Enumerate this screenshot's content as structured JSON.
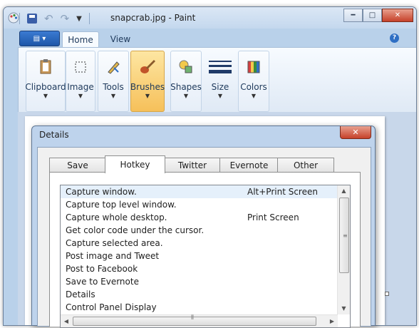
{
  "paint": {
    "title": "snapcrab.jpg - Paint",
    "tabs": [
      "Home",
      "View"
    ],
    "groups": [
      {
        "label": "Clipboard",
        "icon": "clipboard-icon"
      },
      {
        "label": "Image",
        "icon": "select-icon"
      },
      {
        "label": "Tools",
        "icon": "pencil-icon"
      },
      {
        "label": "Brushes",
        "icon": "brush-icon",
        "selected": true
      },
      {
        "label": "Shapes",
        "icon": "shapes-icon"
      },
      {
        "label": "Size",
        "icon": "line-size-icon"
      },
      {
        "label": "Colors",
        "icon": "color-palette-icon"
      }
    ],
    "help_glyph": "?"
  },
  "dialog": {
    "title": "Details",
    "close_glyph": "✕",
    "tabs": [
      "Save",
      "Hotkey",
      "Twitter",
      "Evernote",
      "Other"
    ],
    "active_tab": "Hotkey",
    "rows": [
      {
        "action": "Capture window.",
        "key": "Alt+Print Screen"
      },
      {
        "action": "Capture top level window.",
        "key": ""
      },
      {
        "action": "Capture whole desktop.",
        "key": "Print Screen"
      },
      {
        "action": "Get color code under the cursor.",
        "key": ""
      },
      {
        "action": "Capture selected area.",
        "key": ""
      },
      {
        "action": "Post image and Tweet",
        "key": ""
      },
      {
        "action": "Post to Facebook",
        "key": ""
      },
      {
        "action": "Save to Evernote",
        "key": ""
      },
      {
        "action": "Details",
        "key": ""
      },
      {
        "action": "Control Panel Display",
        "key": ""
      }
    ]
  },
  "colors": {
    "accent": "#2f6fc4",
    "selected_group": "#f6c05a",
    "close_button": "#c6412a",
    "selected_row": "#e5f0fb"
  }
}
